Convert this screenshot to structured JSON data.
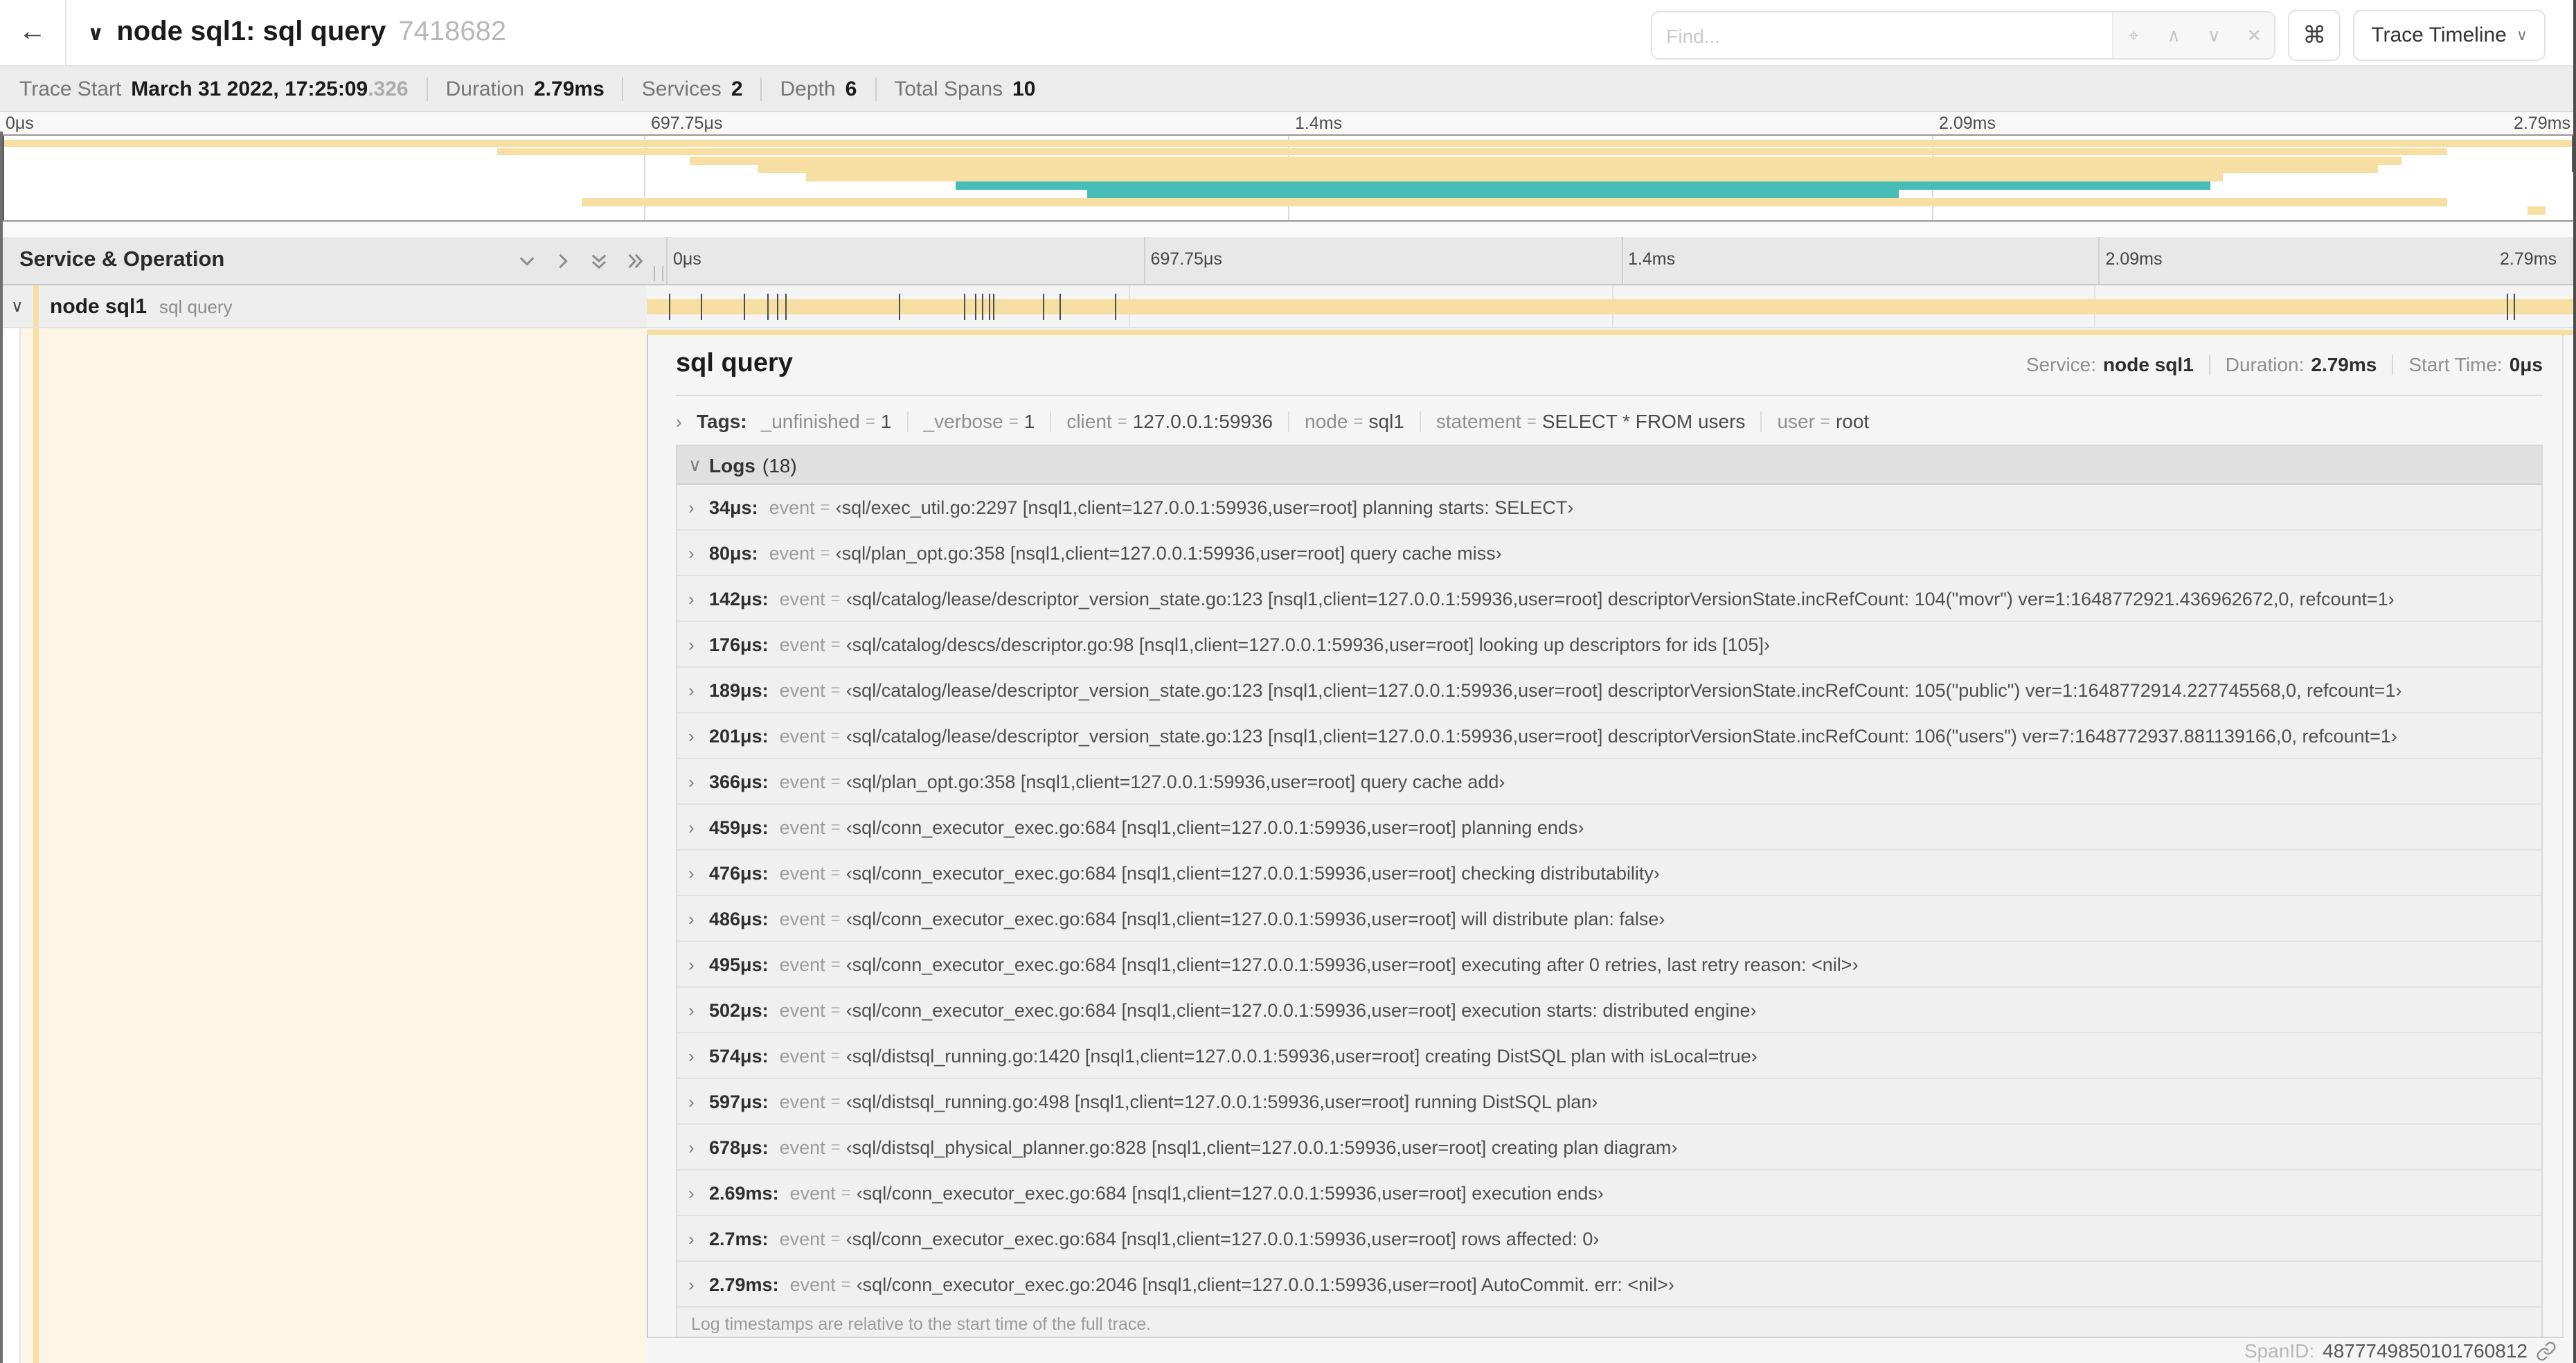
{
  "header": {
    "back_glyph": "←",
    "collapse_glyph": "∨",
    "title": "node sql1: sql query",
    "trace_id": "7418682",
    "find_placeholder": "Find...",
    "find_icons": [
      {
        "name": "locate-icon",
        "glyph": "⌖"
      },
      {
        "name": "chevron-up-icon",
        "glyph": "∧"
      },
      {
        "name": "chevron-down-icon",
        "glyph": "∨"
      },
      {
        "name": "close-icon",
        "glyph": "✕"
      }
    ],
    "kbd_glyph": "⌘",
    "view_button_label": "Trace Timeline",
    "view_button_chevron": "∨"
  },
  "trace_meta": [
    {
      "label": "Trace Start",
      "value": "March 31 2022, 17:25:09",
      "suffix": ".326"
    },
    {
      "label": "Duration",
      "value": "2.79ms"
    },
    {
      "label": "Services",
      "value": "2"
    },
    {
      "label": "Depth",
      "value": "6"
    },
    {
      "label": "Total Spans",
      "value": "10"
    }
  ],
  "trace": {
    "total_us": 2790
  },
  "time_ticks": [
    "0μs",
    "697.75μs",
    "1.4ms",
    "2.09ms",
    "2.79ms"
  ],
  "colors": {
    "tan": "#f7dfa4",
    "teal": "#45bdb6"
  },
  "minimap": {
    "rows": [
      {
        "l": 0,
        "r": 100,
        "color": "tan"
      },
      {
        "l": 19.3,
        "r": 95.0,
        "color": "tan"
      },
      {
        "l": 26.8,
        "r": 93.2,
        "color": "tan"
      },
      {
        "l": 29.4,
        "r": 92.3,
        "color": "tan"
      },
      {
        "l": 31.3,
        "r": 86.3,
        "color": "tan"
      },
      {
        "l": 37.1,
        "r": 85.8,
        "color": "teal"
      },
      {
        "l": 42.2,
        "r": 73.7,
        "color": "teal"
      },
      {
        "l": 22.6,
        "r": 95.0,
        "color": "tan"
      },
      {
        "l": 98.1,
        "r": 98.8,
        "color": "tan"
      }
    ]
  },
  "left_panel": {
    "header_label": "Service & Operation",
    "row": {
      "chevron": "∨",
      "service": "node sql1",
      "operation": "sql query"
    }
  },
  "span_detail": {
    "title": "sql query",
    "stats": [
      {
        "label": "Service:",
        "value": "node sql1"
      },
      {
        "label": "Duration:",
        "value": "2.79ms"
      },
      {
        "label": "Start Time:",
        "value": "0μs"
      }
    ],
    "tags_chevron": "›",
    "tags_label": "Tags:",
    "tags": [
      {
        "key": "_unfinished",
        "value": "1"
      },
      {
        "key": "_verbose",
        "value": "1"
      },
      {
        "key": "client",
        "value": "127.0.0.1:59936"
      },
      {
        "key": "node",
        "value": "sql1"
      },
      {
        "key": "statement",
        "value": "SELECT * FROM users"
      },
      {
        "key": "user",
        "value": "root"
      }
    ],
    "logs_chevron": "∨",
    "logs_label": "Logs",
    "logs_count": "(18)",
    "log_key": "event",
    "logs": [
      {
        "time": "34μs:",
        "t_us": 34,
        "event": "‹sql/exec_util.go:2297 [nsql1,client=127.0.0.1:59936,user=root] planning starts: SELECT›"
      },
      {
        "time": "80μs:",
        "t_us": 80,
        "event": "‹sql/plan_opt.go:358 [nsql1,client=127.0.0.1:59936,user=root] query cache miss›"
      },
      {
        "time": "142μs:",
        "t_us": 142,
        "event": "‹sql/catalog/lease/descriptor_version_state.go:123 [nsql1,client=127.0.0.1:59936,user=root] descriptorVersionState.incRefCount: 104(\"movr\") ver=1:1648772921.436962672,0, refcount=1›"
      },
      {
        "time": "176μs:",
        "t_us": 176,
        "event": "‹sql/catalog/descs/descriptor.go:98 [nsql1,client=127.0.0.1:59936,user=root] looking up descriptors for ids [105]›"
      },
      {
        "time": "189μs:",
        "t_us": 189,
        "event": "‹sql/catalog/lease/descriptor_version_state.go:123 [nsql1,client=127.0.0.1:59936,user=root] descriptorVersionState.incRefCount: 105(\"public\") ver=1:1648772914.227745568,0, refcount=1›"
      },
      {
        "time": "201μs:",
        "t_us": 201,
        "event": "‹sql/catalog/lease/descriptor_version_state.go:123 [nsql1,client=127.0.0.1:59936,user=root] descriptorVersionState.incRefCount: 106(\"users\") ver=7:1648772937.881139166,0, refcount=1›"
      },
      {
        "time": "366μs:",
        "t_us": 366,
        "event": "‹sql/plan_opt.go:358 [nsql1,client=127.0.0.1:59936,user=root] query cache add›"
      },
      {
        "time": "459μs:",
        "t_us": 459,
        "event": "‹sql/conn_executor_exec.go:684 [nsql1,client=127.0.0.1:59936,user=root] planning ends›"
      },
      {
        "time": "476μs:",
        "t_us": 476,
        "event": "‹sql/conn_executor_exec.go:684 [nsql1,client=127.0.0.1:59936,user=root] checking distributability›"
      },
      {
        "time": "486μs:",
        "t_us": 486,
        "event": "‹sql/conn_executor_exec.go:684 [nsql1,client=127.0.0.1:59936,user=root] will distribute plan: false›"
      },
      {
        "time": "495μs:",
        "t_us": 495,
        "event": "‹sql/conn_executor_exec.go:684 [nsql1,client=127.0.0.1:59936,user=root] executing after 0 retries, last retry reason: <nil>›"
      },
      {
        "time": "502μs:",
        "t_us": 502,
        "event": "‹sql/conn_executor_exec.go:684 [nsql1,client=127.0.0.1:59936,user=root] execution starts: distributed engine›"
      },
      {
        "time": "574μs:",
        "t_us": 574,
        "event": "‹sql/distsql_running.go:1420 [nsql1,client=127.0.0.1:59936,user=root] creating DistSQL plan with isLocal=true›"
      },
      {
        "time": "597μs:",
        "t_us": 597,
        "event": "‹sql/distsql_running.go:498 [nsql1,client=127.0.0.1:59936,user=root] running DistSQL plan›"
      },
      {
        "time": "678μs:",
        "t_us": 678,
        "event": "‹sql/distsql_physical_planner.go:828 [nsql1,client=127.0.0.1:59936,user=root] creating plan diagram›"
      },
      {
        "time": "2.69ms:",
        "t_us": 2690,
        "event": "‹sql/conn_executor_exec.go:684 [nsql1,client=127.0.0.1:59936,user=root] execution ends›"
      },
      {
        "time": "2.7ms:",
        "t_us": 2700,
        "event": "‹sql/conn_executor_exec.go:684 [nsql1,client=127.0.0.1:59936,user=root] rows affected: 0›"
      },
      {
        "time": "2.79ms:",
        "t_us": 2790,
        "event": "‹sql/conn_executor_exec.go:2046 [nsql1,client=127.0.0.1:59936,user=root] AutoCommit. err: <nil>›"
      }
    ],
    "footer_note": "Log timestamps are relative to the start time of the full trace.",
    "span_id_label": "SpanID:",
    "span_id": "4877749850101760812"
  }
}
